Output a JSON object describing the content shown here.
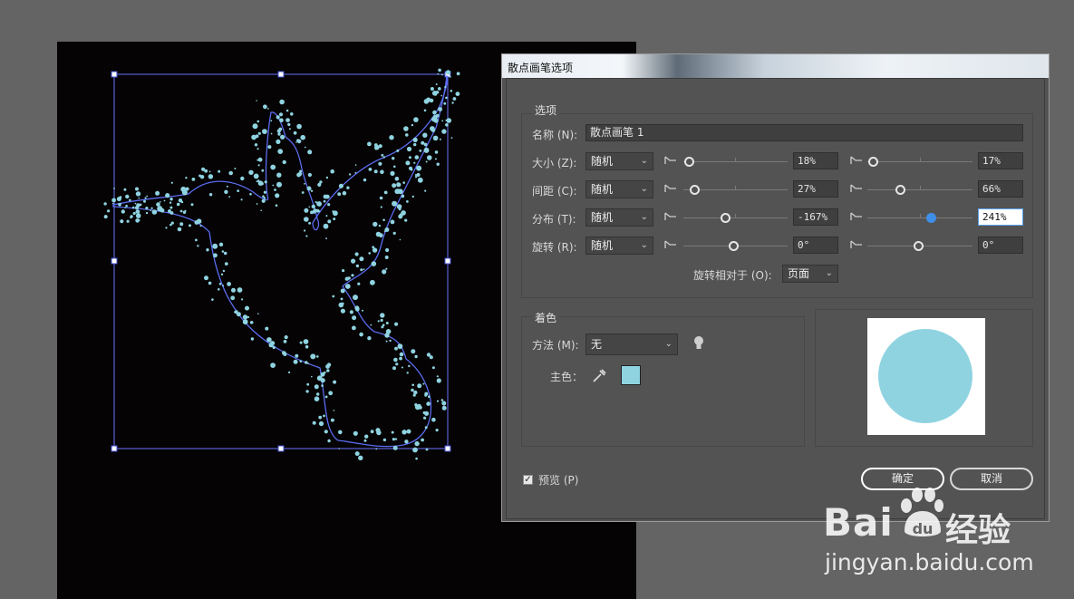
{
  "dialog": {
    "title": "散点画笔选项",
    "options_group": "选项",
    "name": {
      "label": "名称 (N):",
      "value": "散点画笔 1"
    },
    "rows": [
      {
        "label": "大小 (Z):",
        "mode": "随机",
        "v1": "18%",
        "v2": "17%"
      },
      {
        "label": "间距 (C):",
        "mode": "随机",
        "v1": "27%",
        "v2": "66%"
      },
      {
        "label": "分布 (T):",
        "mode": "随机",
        "v1": "-167%",
        "v2": "241%"
      },
      {
        "label": "旋转 (R):",
        "mode": "随机",
        "v1": "0°",
        "v2": "0°"
      }
    ],
    "rotation_relative": {
      "label": "旋转相对于 (O):",
      "value": "页面"
    },
    "colorization": {
      "group": "着色",
      "method_label": "方法 (M):",
      "method_value": "无",
      "key_color_label": "主色："
    },
    "preview": {
      "label": "预览 (P)",
      "checked": true
    },
    "buttons": {
      "ok": "确定",
      "cancel": "取消"
    }
  },
  "colors": {
    "brush_dot": "#8fd3e1",
    "path": "#5a6cf0",
    "active_slider": "#3f8fe8"
  },
  "watermark": {
    "brand": "Bai",
    "brand2": "经验",
    "url": "jingyan.baidu.com"
  }
}
